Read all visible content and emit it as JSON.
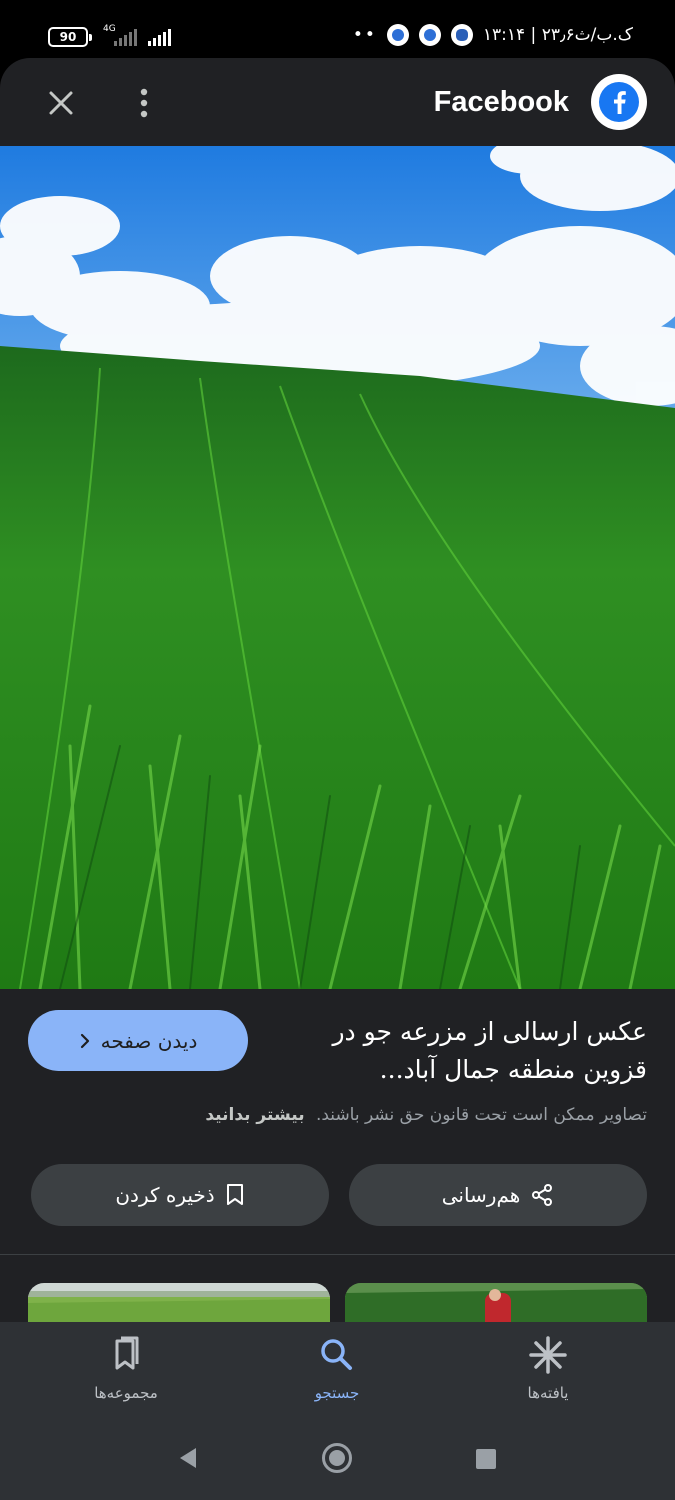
{
  "status_bar": {
    "battery": "90",
    "network": "4G",
    "time": "۱۳:۱۴ | ۲۳٫۶ک.ب/ث",
    "dots": "••"
  },
  "header": {
    "site_name": "Facebook"
  },
  "result": {
    "title": "عکس ارسالی از مزرعه جو در قزوین منطقه جمال آباد...",
    "visit_label": "دیدن صفحه",
    "copyright_text": "تصاویر ممکن است تحت قانون حق نشر باشند.",
    "learn_more": "بیشتر بدانید",
    "share_label": "هم‌رسانی",
    "save_label": "ذخیره کردن"
  },
  "bottom_nav": {
    "items": [
      {
        "label": "مجموعه‌ها",
        "icon": "bookmarks-icon"
      },
      {
        "label": "جستجو",
        "icon": "search-icon"
      },
      {
        "label": "یافته‌ها",
        "icon": "discover-asterisk-icon"
      }
    ],
    "active": "جستجو"
  },
  "colors": {
    "background": "#202124",
    "accent": "#8ab4f8",
    "button": "#3c4043",
    "facebook": "#1877f2"
  }
}
